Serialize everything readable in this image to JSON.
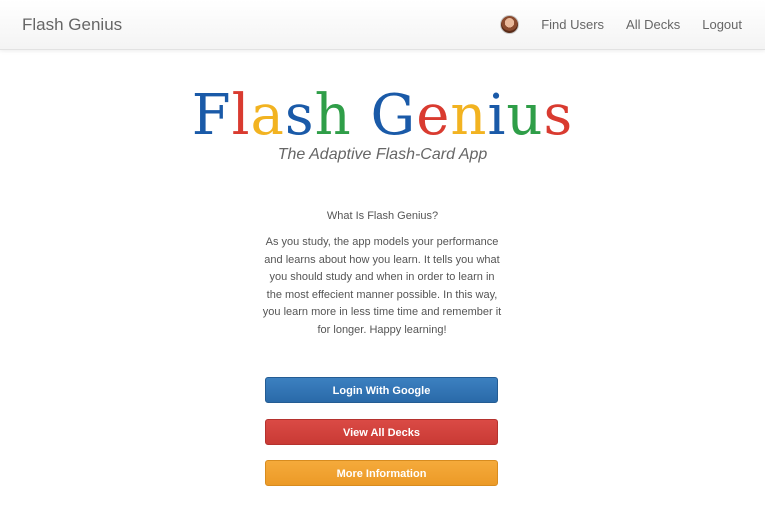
{
  "navbar": {
    "brand": "Flash Genius",
    "links": [
      {
        "label": "Find Users"
      },
      {
        "label": "All Decks"
      },
      {
        "label": "Logout"
      }
    ]
  },
  "logo": {
    "letters": [
      {
        "char": "F",
        "color": "#1a5aa8"
      },
      {
        "char": "l",
        "color": "#d93b30"
      },
      {
        "char": "a",
        "color": "#f2b321"
      },
      {
        "char": "s",
        "color": "#1a5aa8"
      },
      {
        "char": "h",
        "color": "#2f9e48"
      },
      {
        "char": " ",
        "color": "#ffffff"
      },
      {
        "char": "G",
        "color": "#1a5aa8"
      },
      {
        "char": "e",
        "color": "#d93b30"
      },
      {
        "char": "n",
        "color": "#f2b321"
      },
      {
        "char": "i",
        "color": "#1a5aa8"
      },
      {
        "char": "u",
        "color": "#2f9e48"
      },
      {
        "char": "s",
        "color": "#d93b30"
      }
    ]
  },
  "tagline": "The Adaptive Flash-Card App",
  "about": {
    "title": "What Is Flash Genius?",
    "lines": [
      "As you study, the app models your performance",
      "and learns about how you learn. It tells you what",
      "you should study and when in order to learn in",
      "the most effecient manner possible. In this way,",
      "you learn more in less time time and remember it",
      "for longer. Happy learning!"
    ]
  },
  "buttons": {
    "google": "Login With Google",
    "decks": "View All Decks",
    "info": "More Information"
  }
}
